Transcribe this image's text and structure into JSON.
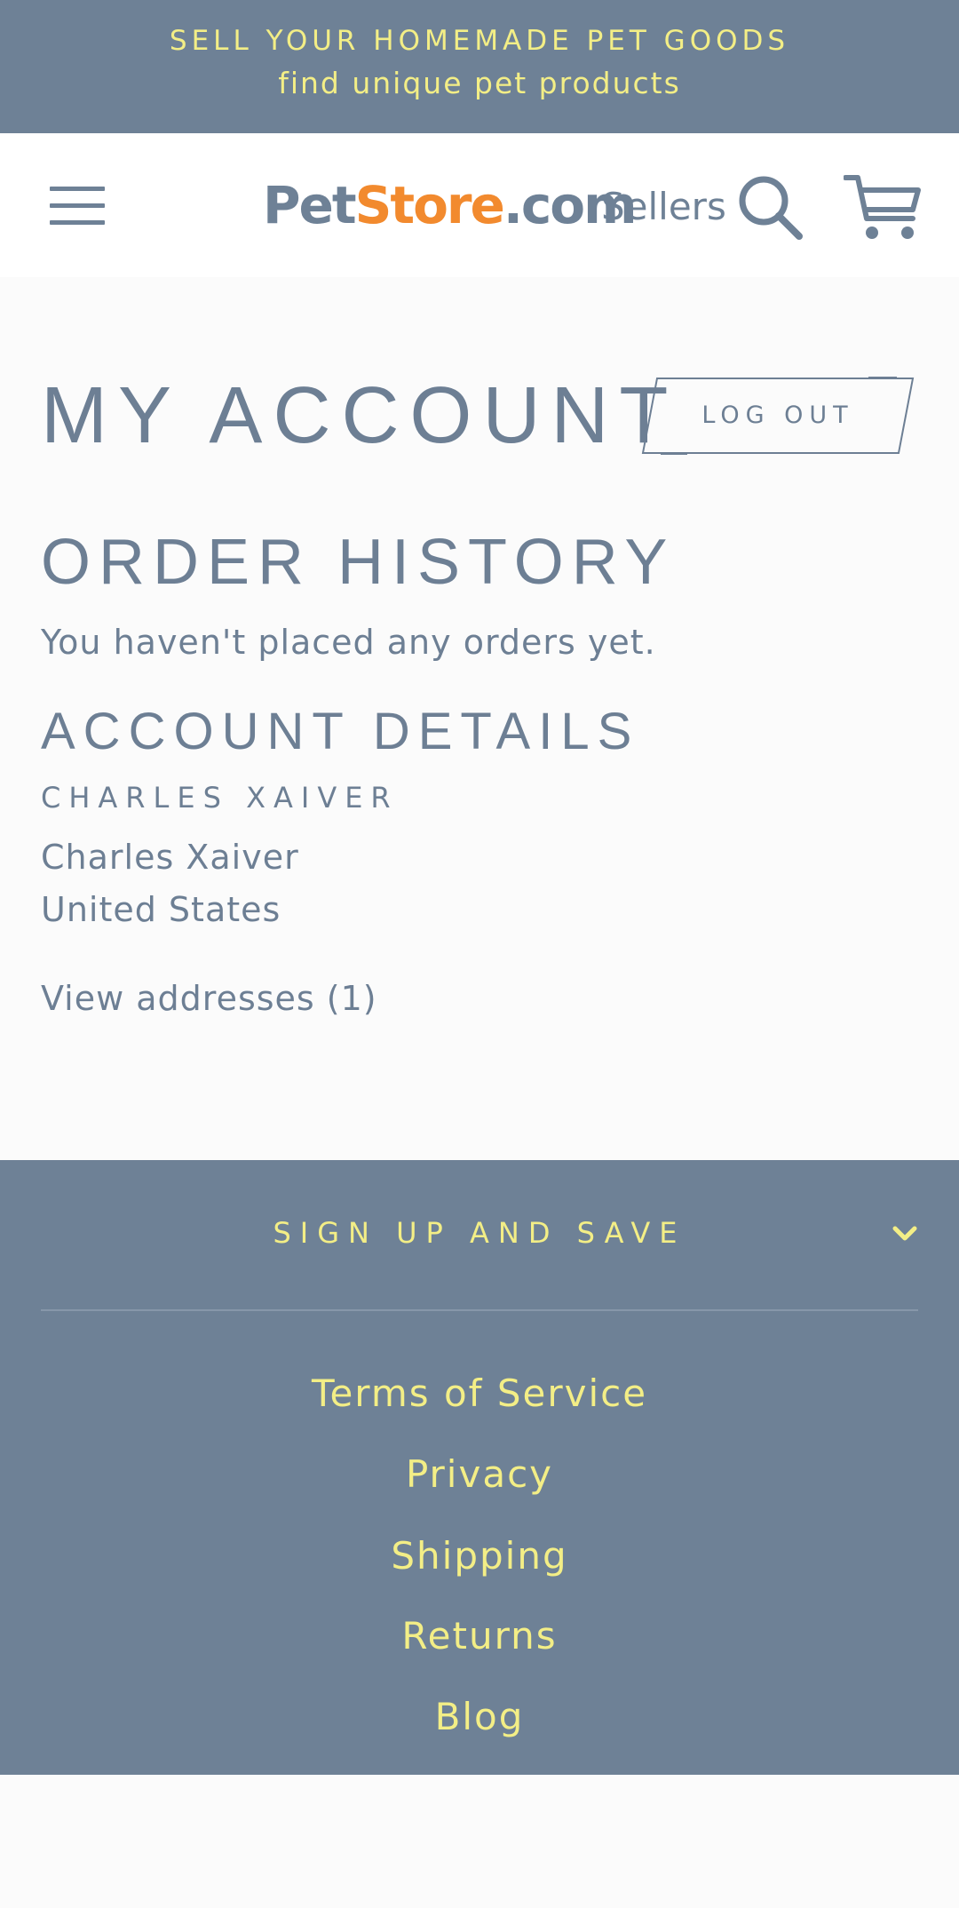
{
  "announcement": {
    "line1": "SELL YOUR HOMEMADE PET GOODS",
    "line2": "find unique pet products"
  },
  "header": {
    "logo": {
      "part1": "Pet",
      "part2": "Store",
      "part3": ".com"
    },
    "sellers_label": "Sellers",
    "icons": {
      "menu": "hamburger-menu-icon",
      "search": "search-icon",
      "cart": "cart-icon"
    },
    "colors": {
      "brand_slate": "#6e8196",
      "brand_orange": "#f28a2e"
    }
  },
  "account": {
    "title": "MY ACCOUNT",
    "logout_label": "LOG OUT",
    "order_history_title": "ORDER HISTORY",
    "empty_orders_message": "You haven't placed any orders yet.",
    "details_title": "ACCOUNT DETAILS",
    "customer_name_label": "CHARLES XAIVER",
    "address_name": "Charles Xaiver",
    "address_country": "United States",
    "view_addresses_label": "View addresses (1)"
  },
  "footer": {
    "signup_label": "SIGN UP AND SAVE",
    "signup_icon": "chevron-down-icon",
    "links": [
      "Terms of Service",
      "Privacy",
      "Shipping",
      "Returns",
      "Blog"
    ],
    "colors": {
      "background": "#6e8196",
      "link": "#f3ee86"
    }
  }
}
